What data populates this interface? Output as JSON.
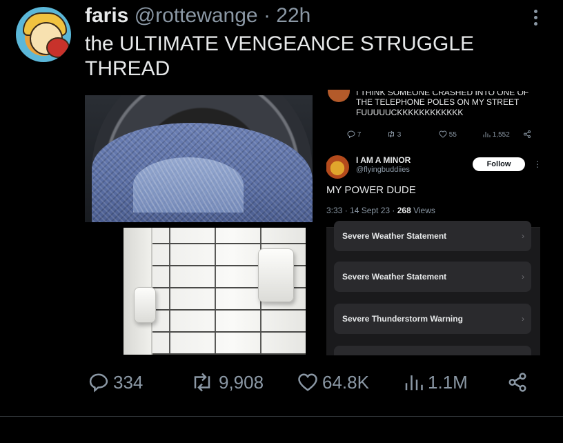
{
  "tweet": {
    "name": "faris",
    "handle": "@rottewange",
    "separator": "·",
    "time": "22h",
    "text": "the ULTIMATE VENGEANCE STRUGGLE THREAD"
  },
  "embedded": {
    "previous_text_cut": "I THINK SOMEONE CRASHED INTO ONE OF",
    "previous_text": "THE TELEPHONE POLES ON MY STREET FUUUUUCKKKKKKKKKKKK",
    "previous_actions": {
      "replies": "7",
      "reposts": "3",
      "likes": "55",
      "views": "1,552"
    },
    "user_name": "I AM A MINOR",
    "user_handle": "@flyingbuddiies",
    "follow_label": "Follow",
    "body": "MY POWER DUDE",
    "timestamp": "3:33 · 14 Sept 23 · ",
    "views_count": "268",
    "views_label": " Views",
    "alerts": [
      "Severe Weather Statement",
      "Severe Weather Statement",
      "Severe Thunderstorm Warning",
      ""
    ]
  },
  "actions": {
    "replies": "334",
    "reposts": "9,908",
    "likes": "64.8K",
    "views": "1.1M"
  },
  "colors": {
    "background": "#000000",
    "text": "#e7e9ea",
    "muted": "#8b98a5",
    "alert_bg": "#2a2a2d"
  },
  "icons": [
    "reply-icon",
    "repost-icon",
    "like-icon",
    "views-icon",
    "share-icon",
    "more-icon"
  ]
}
